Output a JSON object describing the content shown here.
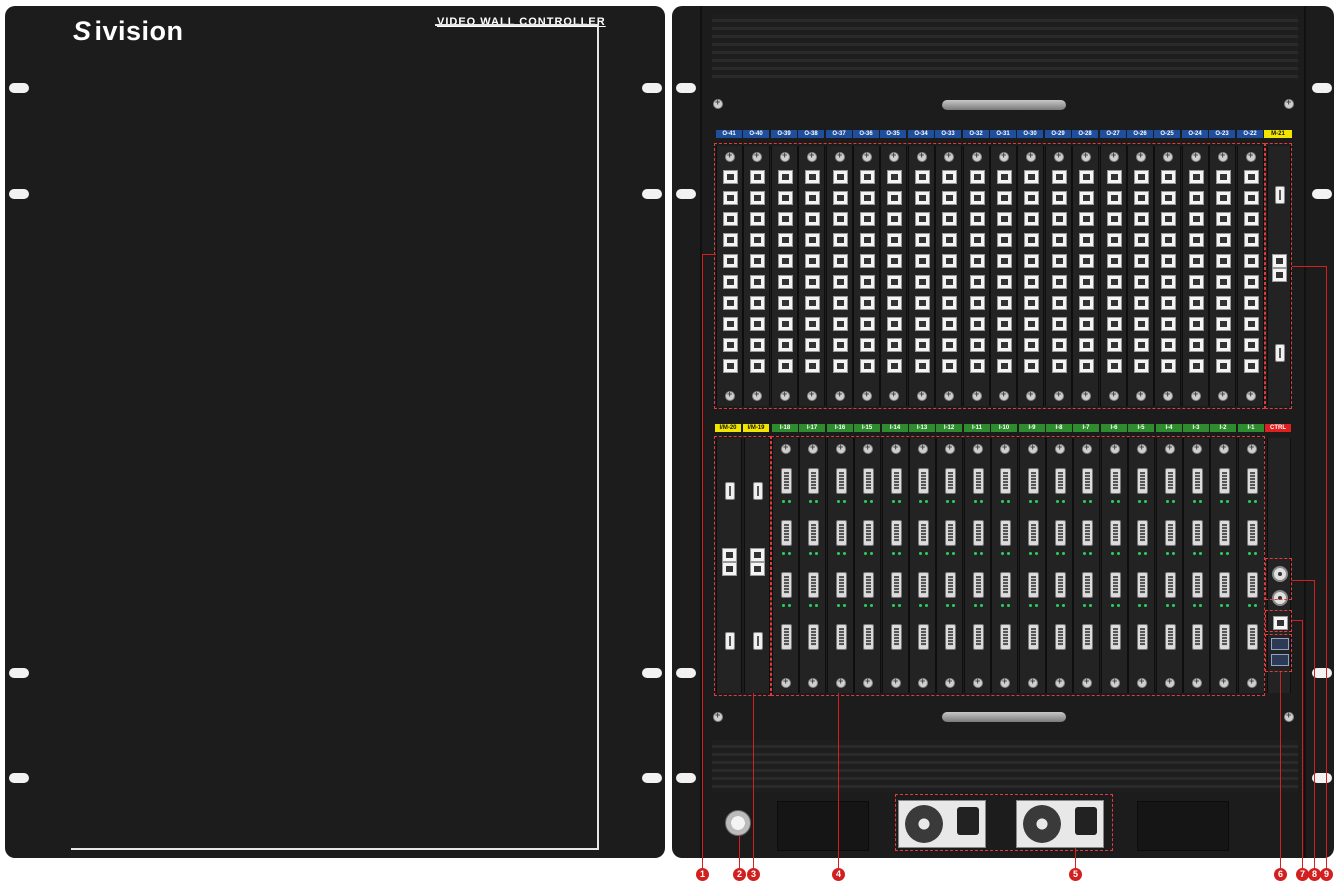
{
  "front_panel": {
    "brand": "ivision",
    "brand_mark": "S",
    "model": "VIDEO WALL CONTROLLER"
  },
  "rear_panel": {
    "output_slot_labels": [
      "O-41",
      "O-40",
      "O-39",
      "O-38",
      "O-37",
      "O-36",
      "O-35",
      "O-34",
      "O-33",
      "O-32",
      "O-31",
      "O-30",
      "O-29",
      "O-28",
      "O-27",
      "O-26",
      "O-25",
      "O-24",
      "O-23",
      "O-22"
    ],
    "output_module_label": "M-21",
    "input_module_labels": [
      "I/M-20",
      "I/M-19"
    ],
    "input_slot_labels": [
      "I-18",
      "I-17",
      "I-16",
      "I-15",
      "I-14",
      "I-13",
      "I-12",
      "I-11",
      "I-10",
      "I-9",
      "I-8",
      "I-7",
      "I-6",
      "I-5",
      "I-4",
      "I-3",
      "I-2",
      "I-1"
    ],
    "ctrl_label": "CTRL",
    "callouts": [
      "1",
      "2",
      "3",
      "4",
      "5",
      "6",
      "7",
      "8",
      "9"
    ]
  },
  "colors": {
    "output_label_bg": "#1f4e9c",
    "module_label_bg": "#f2e500",
    "input_label_bg": "#2e8b2e",
    "ctrl_label_bg": "#e02020",
    "callout": "#d21f1f"
  }
}
